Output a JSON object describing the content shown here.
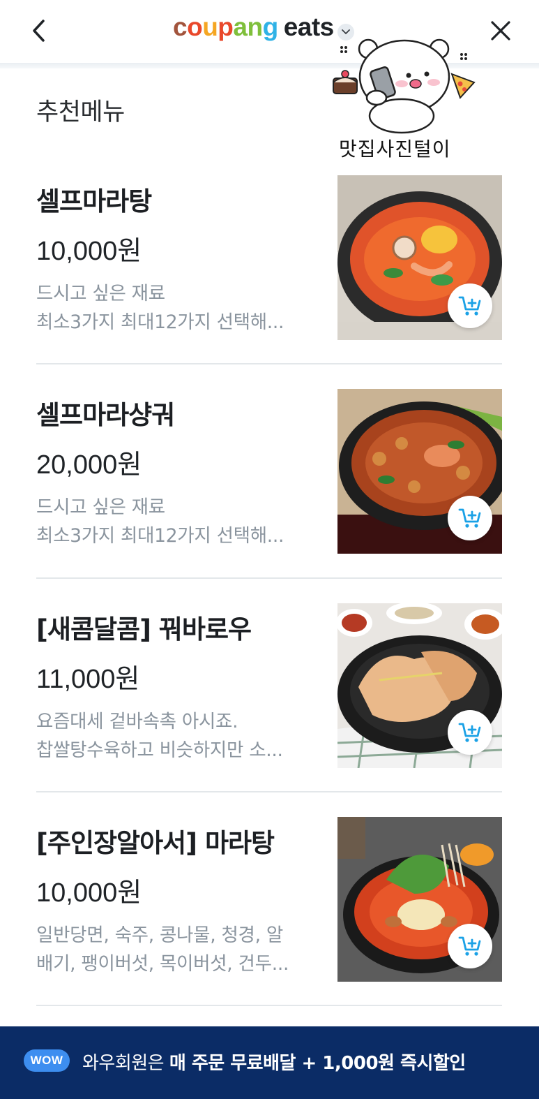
{
  "header": {
    "back_icon": "chevron-left-icon",
    "logo_letters": [
      "c",
      "o",
      "u",
      "p",
      "a",
      "n",
      "g"
    ],
    "logo_coupang_tail": "",
    "logo_eats": "eats",
    "dropdown_icon": "chevron-down-icon",
    "close_icon": "close-icon"
  },
  "sticker": {
    "caption": "맛집사진털이"
  },
  "section_title": "추천메뉴",
  "menu_items": [
    {
      "name": "셀프마라탕",
      "price": "10,000원",
      "desc_line1": "드시고 싶은 재료",
      "desc_line2": "최소3가지 최대12가지 선택해...",
      "cart_icon": "add-to-cart-icon"
    },
    {
      "name": "셀프마라샹궈",
      "price": "20,000원",
      "desc_line1": "드시고 싶은 재료",
      "desc_line2": "최소3가지 최대12가지 선택해...",
      "cart_icon": "add-to-cart-icon"
    },
    {
      "name": "[새콤달콤] 꿔바로우",
      "price": "11,000원",
      "desc_line1": "요즘대세 겉바속촉 아시죠.",
      "desc_line2": "찹쌀탕수육하고 비슷하지만 소...",
      "cart_icon": "add-to-cart-icon"
    },
    {
      "name": "[주인장알아서] 마라탕",
      "price": "10,000원",
      "desc_line1": "일반당면, 숙주, 콩나물, 청경, 알",
      "desc_line2": "배기, 팽이버섯, 목이버섯, 건두...",
      "cart_icon": "add-to-cart-icon"
    }
  ],
  "wow_banner": {
    "badge": "WOW",
    "text_regular": "와우회원은 ",
    "text_bold": "매 주문 무료배달 + 1,000원 즉시할인"
  },
  "colors": {
    "banner_bg": "#0b2c66",
    "badge_bg": "#3d8ef0",
    "cart_icon": "#1aa1e6",
    "desc_text": "#8a949e"
  }
}
